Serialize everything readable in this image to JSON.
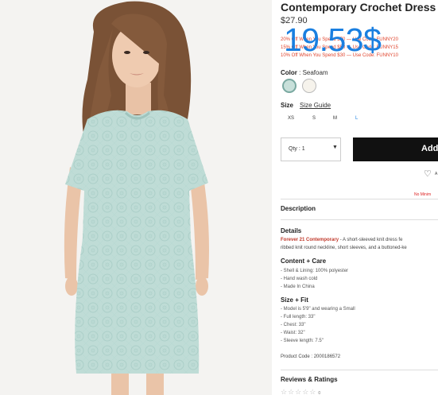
{
  "product": {
    "title": "Contemporary Crochet Dress",
    "price": "$27.90",
    "overlay_price": "19.53$",
    "promos": [
      "20% Off When You Spend $70 — Use Code: FUNNY20",
      "15% Off When You Spend $50 — Use Code: FUNNY15",
      "10% Off When You Spend $30 — Use Code: FUNNY10"
    ],
    "color_label": "Color",
    "color_value": ": Seafoam",
    "colors": [
      {
        "name": "Seafoam",
        "hex": "#c8e0da",
        "selected": true
      },
      {
        "name": "Cream",
        "hex": "#f6f3ec",
        "selected": false
      }
    ],
    "size_label": "Size",
    "size_guide": "Size Guide",
    "sizes": [
      "XS",
      "S",
      "M",
      "L"
    ],
    "qty_label": "Qty : 1",
    "add_label": "Add",
    "wishlist_label": "A",
    "no_min": "No Minim",
    "description_heading": "Description",
    "details_heading": "Details",
    "details_brand": "Forever 21 Contemporary",
    "details_text_1": " - A short-sleeved knit dress fe",
    "details_text_2": "ribbed knit round neckline, short sleeves, and a buttoned-ke",
    "content_heading": "Content + Care",
    "content_items": [
      "- Shell & Lining: 100% polyester",
      "- Hand wash cold",
      "- Made In China"
    ],
    "fit_heading": "Size + Fit",
    "fit_items": [
      "- Model is 5'9\" and wearing a Small",
      "- Full length: 33\"",
      "- Chest: 33\"",
      "- Waist: 32\"",
      "- Sleeve length: 7.5\""
    ],
    "product_code": "Product Code : 2000186572",
    "reviews_heading": "Reviews & Ratings",
    "stars": "☆☆☆☆☆",
    "review_count": "0"
  },
  "colors": {
    "accent": "#1a7fe0",
    "promo": "#e0452e",
    "brand_red": "#c0392b",
    "dress": "#bfdcd6",
    "button": "#111111"
  }
}
